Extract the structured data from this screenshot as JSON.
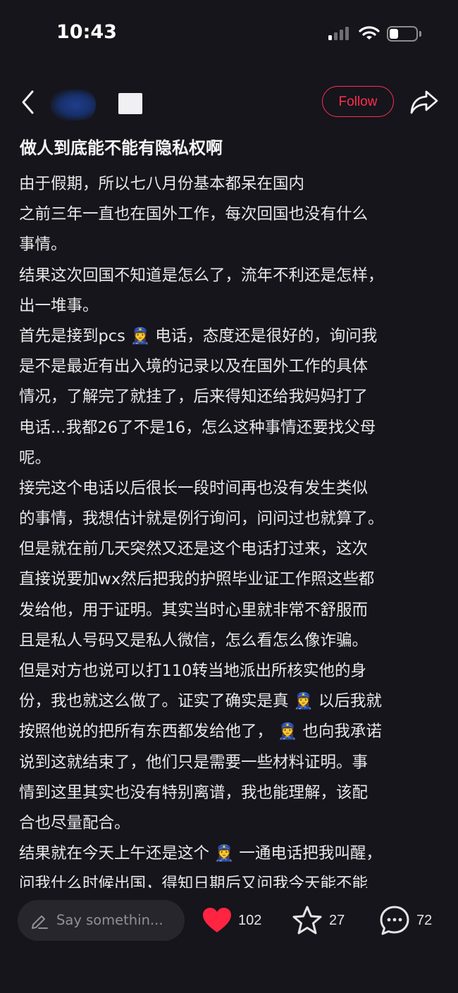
{
  "status_bar": {
    "time": "10:43"
  },
  "nav": {
    "follow_label": "Follow"
  },
  "post": {
    "title": "做人到底能不能有隐私权啊",
    "lines": [
      "由于假期，所以七八月份基本都呆在国内",
      "之前三年一直也在国外工作，每次回国也没有什么",
      "事情。",
      "结果这次回国不知道是怎么了，流年不利还是怎样，",
      "出一堆事。",
      "首先是接到pcs 👮‍♀️ 电话，态度还是很好的，询问我",
      "是不是最近有出入境的记录以及在国外工作的具体",
      "情况，了解完了就挂了，后来得知还给我妈妈打了",
      "电话...我都26了不是16，怎么这种事情还要找父母",
      "呢。",
      "接完这个电话以后很长一段时间再也没有发生类似",
      "的事情，我想估计就是例行询问，问问过也就算了。",
      "但是就在前几天突然又还是这个电话打过来，这次",
      "直接说要加wx然后把我的护照毕业证工作照这些都",
      "发给他，用于证明。其实当时心里就非常不舒服而",
      "且是私人号码又是私人微信，怎么看怎么像诈骗。",
      "但是对方也说可以打110转当地派出所核实他的身",
      "份，我也就这么做了。证实了确实是真 👮‍♀️ 以后我就",
      "按照他说的把所有东西都发给他了， 👮‍♀️ 也向我承诺",
      "说到这就结束了，他们只是需要一些材料证明。事",
      "情到这里其实也没有特别离谱，我也能理解，该配",
      "合也尽量配合。",
      "结果就在今天上午还是这个 👮‍♀️ 一通电话把我叫醒，",
      "问我什么时候出国，得知日期后又问我今天能不能"
    ]
  },
  "bottom_bar": {
    "comment_placeholder": "Say somethin...",
    "like_count": "102",
    "star_count": "27",
    "comment_count": "72"
  },
  "colors": {
    "accent": "#ff2e4f",
    "background": "#15151b",
    "heart": "#ff2442"
  },
  "icons": [
    "back-arrow-icon",
    "share-icon",
    "pencil-icon",
    "heart-icon",
    "star-icon",
    "comment-bubble-icon",
    "police-officer-emoji"
  ]
}
